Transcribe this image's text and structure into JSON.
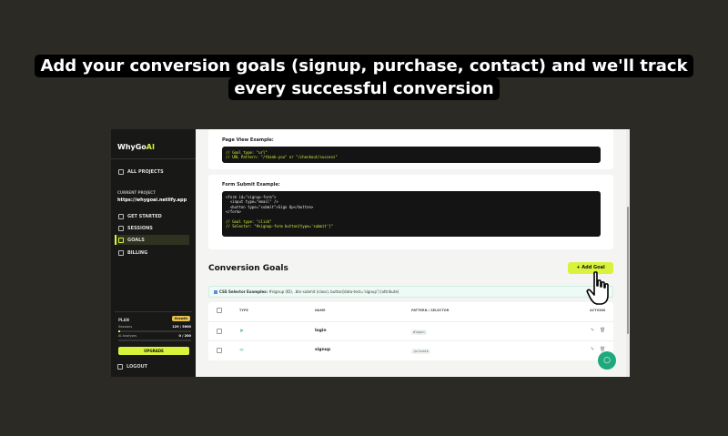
{
  "caption": {
    "line1": "Add your conversion goals (signup, purchase, contact) and we'll track",
    "line2": "every successful conversion"
  },
  "sidebar": {
    "logo_main": "WhyGo",
    "logo_accent": "AI",
    "all_projects": "ALL PROJECTS",
    "current_project_label": "CURRENT PROJECT",
    "current_project": "https://whygoai.netlify.app",
    "items": [
      {
        "label": "GET STARTED",
        "icon": "rocket-icon"
      },
      {
        "label": "SESSIONS",
        "icon": "sessions-icon"
      },
      {
        "label": "GOALS",
        "icon": "target-icon",
        "active": true
      },
      {
        "label": "BILLING",
        "icon": "card-icon"
      }
    ],
    "plan": {
      "label": "PLAN",
      "badge": "Growth",
      "sessions_label": "Sessions",
      "sessions_value": "129 / 5000",
      "sessions_fraction": 0.03,
      "ai_analyses_label": "AI Analyses",
      "ai_analyses_value": "0 / 200",
      "ai_analyses_fraction": 0.0,
      "upgrade": "UPGRADE"
    },
    "logout": "LOGOUT"
  },
  "examples": {
    "page_view_title": "Page View Example:",
    "page_view_code": [
      "// Goal type: \"url\"",
      "// URL Pattern: \"/thank-you\" or \"/checkout/success\""
    ],
    "form_submit_title": "Form Submit Example:",
    "form_submit_code": [
      "<form id=\"signup-form\">",
      "  <input type=\"email\" />",
      "  <button type=\"submit\">Sign Up</button>",
      "</form>",
      "",
      "// Goal type: \"click\"",
      "// Selector: \"#signup-form button[type='submit']\""
    ]
  },
  "conversion_goals": {
    "title": "Conversion Goals",
    "add_button": "+ Add Goal",
    "selector_examples_label": "CSS Selector Examples:",
    "selector_examples_text": "#signup (ID), .btn-submit (class), button[data-test='signup'] (attribute)",
    "columns": [
      "TYPE",
      "NAME",
      "PATTERN / SELECTOR",
      "ACTIONS"
    ],
    "rows": [
      {
        "type_icon": "cursor-click-icon",
        "name": "login",
        "pattern": "#login"
      },
      {
        "type_icon": "link-icon",
        "name": "signup",
        "pattern": "/private"
      }
    ]
  },
  "colors": {
    "accent": "#d9f23b",
    "sidebar_bg": "#181816",
    "chat": "#1ea97c"
  }
}
